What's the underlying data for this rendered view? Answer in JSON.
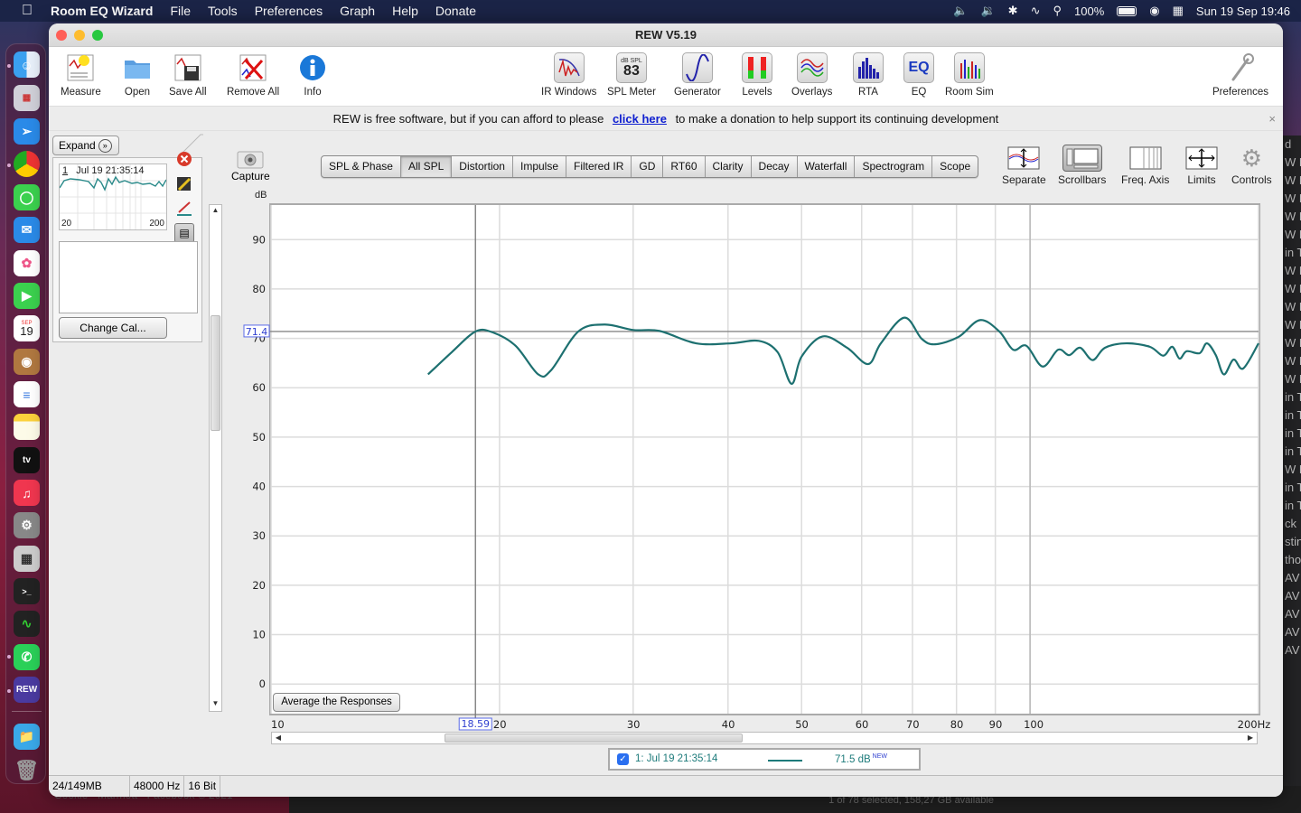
{
  "menubar": {
    "app_name": "Room EQ Wizard",
    "items": [
      "File",
      "Tools",
      "Preferences",
      "Graph",
      "Help",
      "Donate"
    ],
    "battery": "100%",
    "datetime": "Sun 19 Sep  19:46"
  },
  "dock": {
    "apps": [
      "Finder",
      "Launchpad",
      "Safari",
      "Chrome",
      "Messages",
      "Mail",
      "Photos",
      "FaceTime",
      "Calendar",
      "Contacts",
      "Reminders",
      "Notes",
      "Apple TV",
      "Music",
      "System Preferences",
      "Calculator",
      "Terminal",
      "Activity Monitor",
      "WhatsApp",
      "REW",
      "Downloads",
      "Trash"
    ],
    "calendar_month": "SEP",
    "calendar_day": "19"
  },
  "window": {
    "title": "REW V5.19"
  },
  "toolbar": {
    "left": [
      {
        "label": "Measure",
        "icon": "measure-icon"
      },
      {
        "label": "Open",
        "icon": "folder-icon"
      },
      {
        "label": "Save All",
        "icon": "save-icon"
      },
      {
        "label": "Remove All",
        "icon": "remove-icon"
      },
      {
        "label": "Info",
        "icon": "info-icon"
      }
    ],
    "center": [
      {
        "label": "IR Windows",
        "icon": "ir-windows-icon"
      },
      {
        "label": "SPL Meter",
        "icon": "spl-meter-icon"
      },
      {
        "label": "Generator",
        "icon": "generator-icon"
      },
      {
        "label": "Levels",
        "icon": "levels-icon"
      },
      {
        "label": "Overlays",
        "icon": "overlays-icon"
      },
      {
        "label": "RTA",
        "icon": "rta-icon"
      },
      {
        "label": "EQ",
        "icon": "eq-icon"
      },
      {
        "label": "Room Sim",
        "icon": "room-sim-icon"
      }
    ],
    "spl_meter_unit": "dB SPL",
    "spl_meter_value": "83",
    "eq_text": "EQ",
    "preferences": "Preferences"
  },
  "donate": {
    "before": "REW is free software, but if you can afford to please",
    "link": "click here",
    "after": "to make a donation to help support its continuing development",
    "close": "×"
  },
  "left_panel": {
    "expand_label": "Expand",
    "measurement_index": "1",
    "measurement_name": "Jul 19 21:35:14",
    "thumb_min": "20",
    "thumb_max": "200",
    "change_cal_label": "Change Cal..."
  },
  "capture_label": "Capture",
  "graph_tabs": {
    "items": [
      "SPL & Phase",
      "All SPL",
      "Distortion",
      "Impulse",
      "Filtered IR",
      "GD",
      "RT60",
      "Clarity",
      "Decay",
      "Waterfall",
      "Spectrogram",
      "Scope"
    ],
    "active": "All SPL"
  },
  "graph_tools": [
    {
      "label": "Separate"
    },
    {
      "label": "Scrollbars"
    },
    {
      "label": "Freq. Axis"
    },
    {
      "label": "Limits"
    },
    {
      "label": "Controls"
    }
  ],
  "average_button": "Average the Responses",
  "legend": {
    "checked": true,
    "name": "1: Jul 19 21:35:14",
    "value": "71.5 dB",
    "badge": "NEW"
  },
  "statusbar": {
    "memory": "24/149MB",
    "sample_rate": "48000 Hz",
    "bit_depth": "16 Bit"
  },
  "background": {
    "finder_status": "1 of 78 selected, 158,27 GB available",
    "caption": "Cookie · Marmott · Facebook © 2021",
    "right_column": [
      "d",
      "W M",
      "W M",
      "W M",
      "W M",
      "W M",
      "in T",
      "W M",
      "W M",
      "W M",
      "W M",
      "W M",
      "W M",
      "W M",
      "in T",
      "in T",
      "in T",
      "in T",
      "W M",
      "in T",
      "in T",
      "ck",
      "stin",
      "thor",
      "AV",
      "AV",
      "AV",
      "AV",
      "AV"
    ]
  },
  "chart_data": {
    "type": "line",
    "title": "All SPL",
    "xlabel": "Hz",
    "ylabel": "dB",
    "xscale": "log",
    "xlim": [
      10,
      200
    ],
    "ylim": [
      -6,
      97
    ],
    "x_ticks": [
      10,
      20,
      30,
      40,
      50,
      60,
      70,
      80,
      90,
      100,
      200
    ],
    "x_tick_labels": [
      "10",
      "20",
      "30",
      "40",
      "50",
      "60",
      "70",
      "80",
      "90",
      "100",
      "200Hz"
    ],
    "y_ticks": [
      0,
      10,
      20,
      30,
      40,
      50,
      60,
      70,
      80,
      90
    ],
    "y_tick_labels": [
      "0",
      "10",
      "20",
      "30",
      "40",
      "50",
      "60",
      "70",
      "80",
      "90"
    ],
    "grid": true,
    "cursor": {
      "x": 18.59,
      "y": 71.4,
      "x_label": "18.59",
      "y_label": "71.4"
    },
    "series": [
      {
        "name": "1: Jul 19 21:35:14",
        "color": "#1d7070",
        "x": [
          16.1,
          17.3,
          18.6,
          19.6,
          21.0,
          22.5,
          23.4,
          25.4,
          27.5,
          30.0,
          32.5,
          36.3,
          40.4,
          43.9,
          46.5,
          48.5,
          50.0,
          53.3,
          57.4,
          61.2,
          63.6,
          68.3,
          72.0,
          75.0,
          80.5,
          85.9,
          91.1,
          95.0,
          98.9,
          103.9,
          108.9,
          112.6,
          116.4,
          120.9,
          125.5,
          133.8,
          143.8,
          149.8,
          153.9,
          157.4,
          160.8,
          167.3,
          171.0,
          175.7,
          180.0,
          185.4,
          190.9,
          200.0
        ],
        "y": [
          62.7,
          67.2,
          71.4,
          71.2,
          68.5,
          62.7,
          63.6,
          71.4,
          72.8,
          71.7,
          71.5,
          69.0,
          69.0,
          69.5,
          67.2,
          60.8,
          66.3,
          70.4,
          68.1,
          64.8,
          69.0,
          74.2,
          69.9,
          68.8,
          70.3,
          73.7,
          71.4,
          67.7,
          68.5,
          64.3,
          67.7,
          66.6,
          68.1,
          65.6,
          68.1,
          69.0,
          68.3,
          66.5,
          68.3,
          65.9,
          67.4,
          67.0,
          69.0,
          66.6,
          62.7,
          65.7,
          63.9,
          69.0
        ]
      }
    ]
  }
}
